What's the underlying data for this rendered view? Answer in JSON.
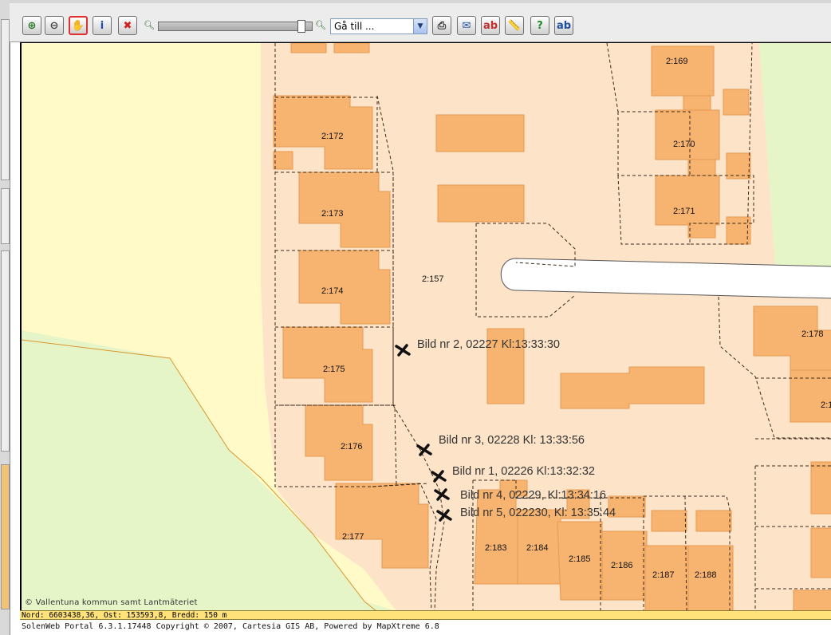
{
  "toolbar": {
    "buttons": [
      {
        "name": "zoom-in-button",
        "icon": "magnifier-plus-icon",
        "glyph": "⊕",
        "color": "#2a7a2a"
      },
      {
        "name": "zoom-out-button",
        "icon": "magnifier-minus-icon",
        "glyph": "⊖",
        "color": "#444444"
      },
      {
        "name": "pan-button",
        "icon": "hand-icon",
        "glyph": "✋",
        "color": "#b5651d",
        "active": true
      },
      {
        "name": "info-button",
        "icon": "info-icon",
        "glyph": "i",
        "color": "#1c4fb0"
      },
      {
        "name": "clear-button",
        "icon": "close-icon",
        "glyph": "✖",
        "color": "#d21f1f"
      }
    ],
    "zoom": {
      "minus_icon": "zoom-out-small-icon",
      "plus_icon": "zoom-in-small-icon",
      "level": 0.95
    },
    "goto": {
      "selected": "Gå till ..."
    },
    "right_buttons": [
      {
        "name": "print-button",
        "icon": "printer-icon",
        "glyph": "⎙",
        "color": "#333333"
      },
      {
        "name": "email-button",
        "icon": "envelope-icon",
        "glyph": "✉",
        "color": "#1f4f9f"
      },
      {
        "name": "remove-label-button",
        "icon": "abc-remove-icon",
        "glyph": "ab",
        "color": "#c23030"
      },
      {
        "name": "measure-button",
        "icon": "ruler-icon",
        "glyph": "📏",
        "color": "#a77a1a"
      },
      {
        "name": "help-button",
        "icon": "help-circle-icon",
        "glyph": "?",
        "color": "#1f8a2a"
      },
      {
        "name": "label-button",
        "icon": "abc-label-icon",
        "glyph": "ab",
        "color": "#1f4f9f"
      }
    ]
  },
  "map": {
    "colors": {
      "background": "#fffac8",
      "property": "#fde3c8",
      "green": "#e6f5c8",
      "building": "#f7b370",
      "building_stroke": "#e59a4f",
      "road": "#ffffff",
      "boundary": "#3b2a1a",
      "contour": "#d9972f"
    },
    "parcel_labels": [
      "2:169",
      "2:170",
      "2:171",
      "2:172",
      "2:173",
      "2:174",
      "2:157",
      "2:175",
      "2:176",
      "2:177",
      "2:178",
      "2:1",
      "2:183",
      "2:184",
      "2:185",
      "2:186",
      "2:187",
      "2:188"
    ],
    "photo_labels": [
      "Bild nr 2, 02227 Kl:13:33:30",
      "Bild nr 3, 02228 Kl: 13:33:56",
      "Bild nr 1, 02226 Kl:13:32:32",
      "Bild nr 4, 02229, Kl:13:34:16",
      "Bild nr 5, 022230, Kl: 13:35:44"
    ],
    "photo_marker_icon": "photo-point-cross-icon",
    "copyright": "© Vallentuna kommun samt Lantmäteriet"
  },
  "status": {
    "coordinates": "Nord: 6603438,36, Ost: 153593,8, Bredd: 150 m"
  },
  "footer": {
    "text": "SolenWeb Portal 6.3.1.17448 Copyright © 2007, Cartesia GIS AB, Powered by MapXtreme 6.8"
  }
}
